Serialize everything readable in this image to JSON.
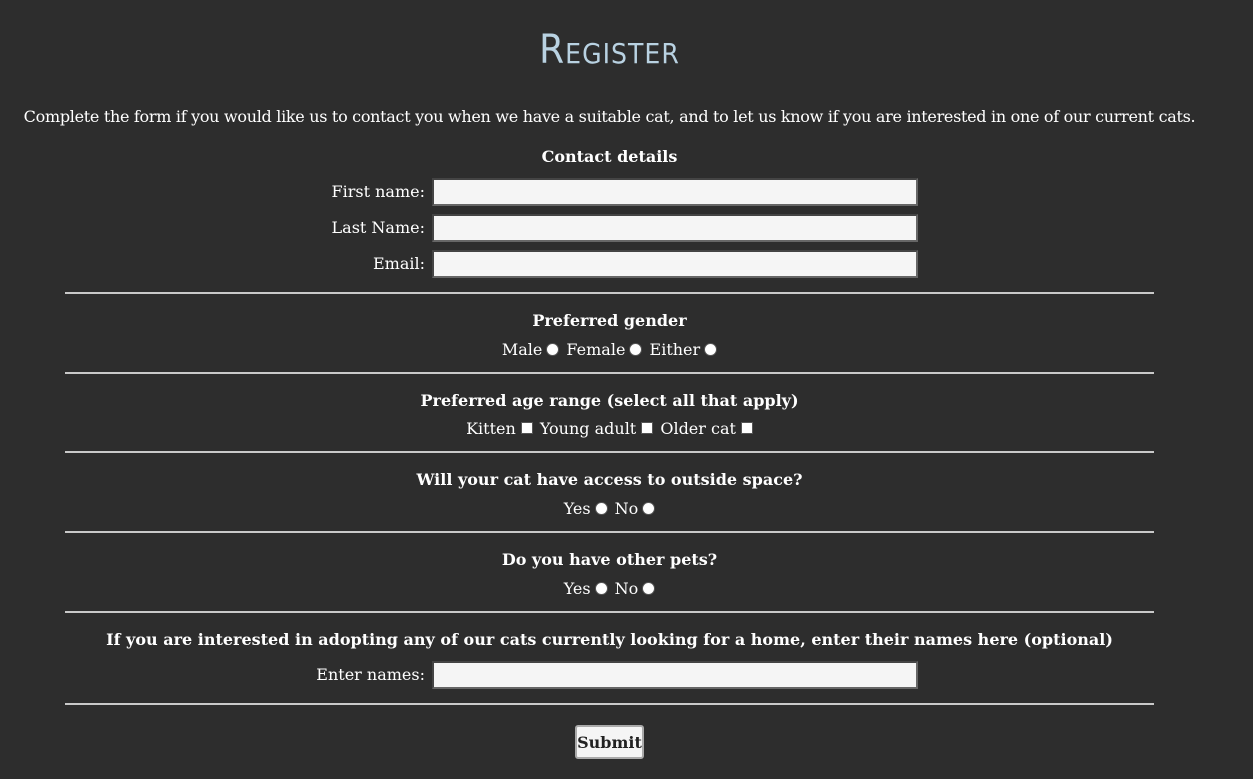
{
  "title": "Register",
  "intro": "Complete the form if you would like us to contact you when we have a suitable cat, and to let us know if you are interested in one of our current cats.",
  "contact": {
    "heading": "Contact details",
    "first_name_label": "First name:",
    "first_name_value": "",
    "last_name_label": "Last Name:",
    "last_name_value": "",
    "email_label": "Email:",
    "email_value": ""
  },
  "gender": {
    "heading": "Preferred gender",
    "options": [
      "Male",
      "Female",
      "Either"
    ]
  },
  "age": {
    "heading": "Preferred age range (select all that apply)",
    "options": [
      "Kitten",
      "Young adult",
      "Older cat"
    ]
  },
  "outside": {
    "heading": "Will your cat have access to outside space?",
    "options": [
      "Yes",
      "No"
    ]
  },
  "pets": {
    "heading": "Do you have other pets?",
    "options": [
      "Yes",
      "No"
    ]
  },
  "adopt": {
    "heading": "If you are interested in adopting any of our cats currently looking for a home, enter their names here (optional)",
    "names_label": "Enter names:",
    "names_value": ""
  },
  "submit_label": "Submit"
}
